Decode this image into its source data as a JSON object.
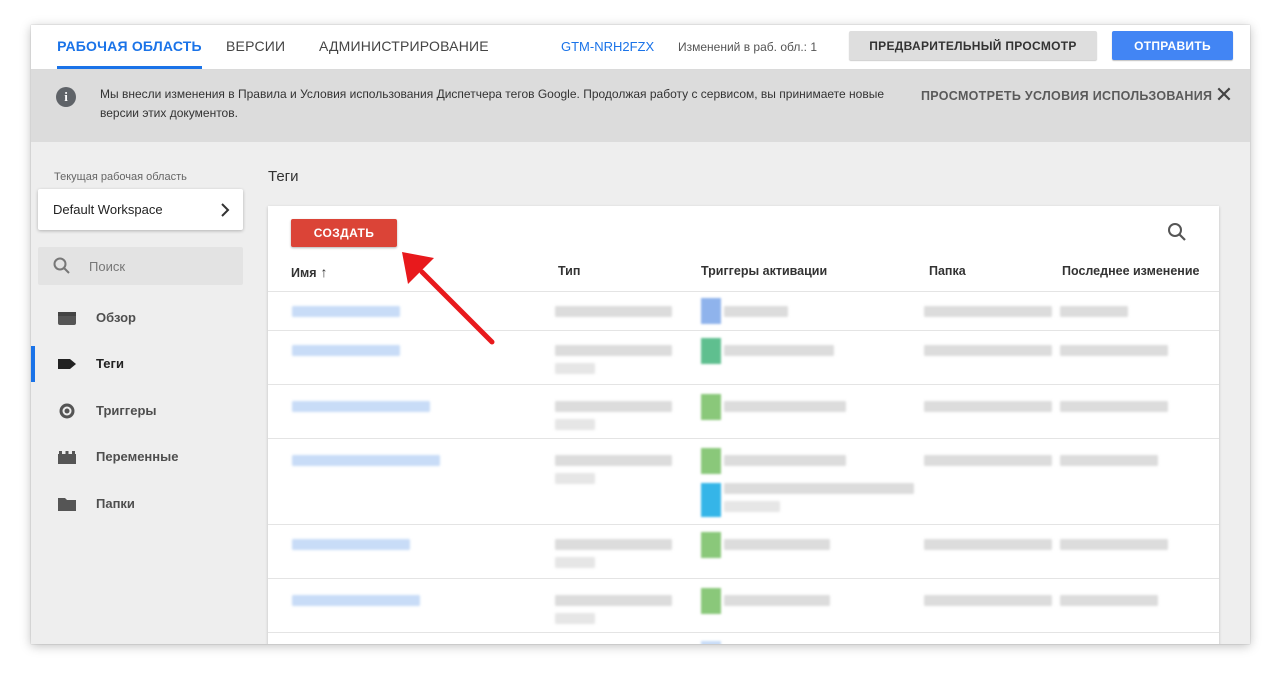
{
  "header": {
    "tabs": [
      {
        "label": "РАБОЧАЯ ОБЛАСТЬ",
        "active": true
      },
      {
        "label": "ВЕРСИИ",
        "active": false
      },
      {
        "label": "АДМИНИСТРИРОВАНИЕ",
        "active": false
      }
    ],
    "container_id": "GTM-NRH2FZX",
    "changes_label": "Изменений в раб. обл.: 1",
    "preview_label": "ПРЕДВАРИТЕЛЬНЫЙ ПРОСМОТР",
    "submit_label": "ОТПРАВИТЬ",
    "accent_color": "#1a73e8",
    "submit_color": "#4285f4"
  },
  "banner": {
    "icon": "info-icon",
    "text": "Мы внесли изменения в Правила и Условия использования Диспетчера тегов Google. Продолжая работу с сервисом, вы принимаете новые версии этих документов.",
    "link_label": "ПРОСМОТРЕТЬ УСЛОВИЯ ИСПОЛЬЗОВАНИЯ",
    "close_icon": "close-icon"
  },
  "sidebar": {
    "workspace_label": "Текущая рабочая область",
    "workspace_name": "Default Workspace",
    "search_placeholder": "Поиск",
    "items": [
      {
        "label": "Обзор",
        "icon": "overview-icon",
        "active": false
      },
      {
        "label": "Теги",
        "icon": "tag-icon",
        "active": true
      },
      {
        "label": "Триггеры",
        "icon": "trigger-icon",
        "active": false
      },
      {
        "label": "Переменные",
        "icon": "variables-icon",
        "active": false
      },
      {
        "label": "Папки",
        "icon": "folder-icon",
        "active": false
      }
    ]
  },
  "main": {
    "title": "Теги",
    "create_label": "СОЗДАТЬ",
    "create_color": "#db4437",
    "columns": [
      "Имя",
      "Тип",
      "Триггеры активации",
      "Папка",
      "Последнее изменение"
    ],
    "sort_indicator": "↑"
  }
}
